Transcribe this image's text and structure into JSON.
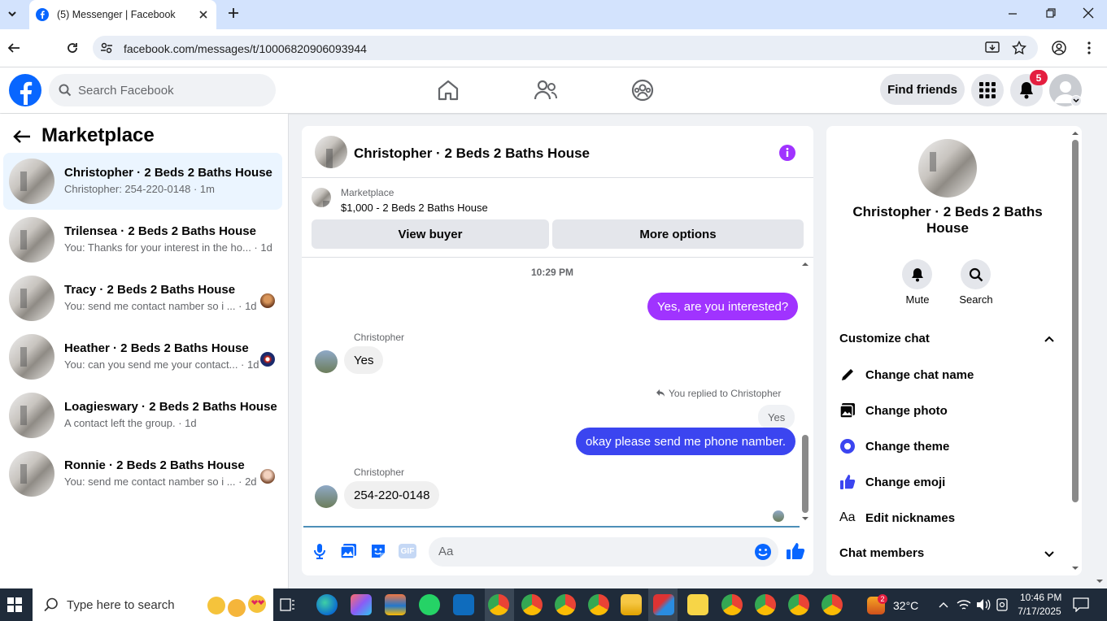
{
  "browser": {
    "tab_title": "(5) Messenger | Facebook",
    "url": "facebook.com/messages/t/10006820906093944"
  },
  "header": {
    "search_placeholder": "Search Facebook",
    "find_friends": "Find friends",
    "notification_count": "5"
  },
  "sidebar": {
    "title": "Marketplace",
    "conversations": [
      {
        "name": "Christopher · 2 Beds 2 Baths House",
        "preview": "Christopher: 254-220-0148 · 1m",
        "selected": true
      },
      {
        "name": "Trilensea · 2 Beds 2 Baths House",
        "preview": "You: Thanks for your interest in the ho... · 1d"
      },
      {
        "name": "Tracy · 2 Beds 2 Baths House",
        "preview": "You: send me contact namber so i ... · 1d"
      },
      {
        "name": "Heather · 2 Beds 2 Baths House",
        "preview": "You: can you send me your contact... · 1d"
      },
      {
        "name": "Loagieswary · 2 Beds 2 Baths House",
        "preview": "A contact left the group. · 1d"
      },
      {
        "name": "Ronnie · 2 Beds 2 Baths House",
        "preview": "You: send me contact namber so i ... · 2d"
      }
    ]
  },
  "chat": {
    "title": "Christopher · 2 Beds 2 Baths House",
    "listing_source": "Marketplace",
    "listing": "$1,000 - 2 Beds 2 Baths House",
    "view_buyer": "View buyer",
    "more_options": "More options",
    "timestamp": "10:29 PM",
    "messages": [
      {
        "from": "me",
        "text": "Yes, are you interested?"
      },
      {
        "sender": "Christopher",
        "text": "Yes"
      },
      {
        "reply_note": "You replied to Christopher",
        "quoted": "Yes",
        "from": "me",
        "text": "okay please send me phone namber."
      },
      {
        "sender": "Christopher",
        "text": "254-220-0148"
      }
    ],
    "composer_placeholder": "Aa",
    "gif_label": "GIF"
  },
  "details": {
    "name": "Christopher · 2 Beds 2 Baths House",
    "mute": "Mute",
    "search": "Search",
    "customize": "Customize chat",
    "options": [
      "Change chat name",
      "Change photo",
      "Change theme",
      "Change emoji",
      "Edit nicknames"
    ],
    "chat_members": "Chat members"
  },
  "taskbar": {
    "search_placeholder": "Type here to search",
    "temperature": "32°C",
    "time": "10:46 PM",
    "date": "7/17/2025",
    "badge": "2"
  },
  "colors": {
    "fb_blue": "#0866ff",
    "messenger_purple": "#a033ff",
    "messenger_blue": "#3b45f0"
  }
}
